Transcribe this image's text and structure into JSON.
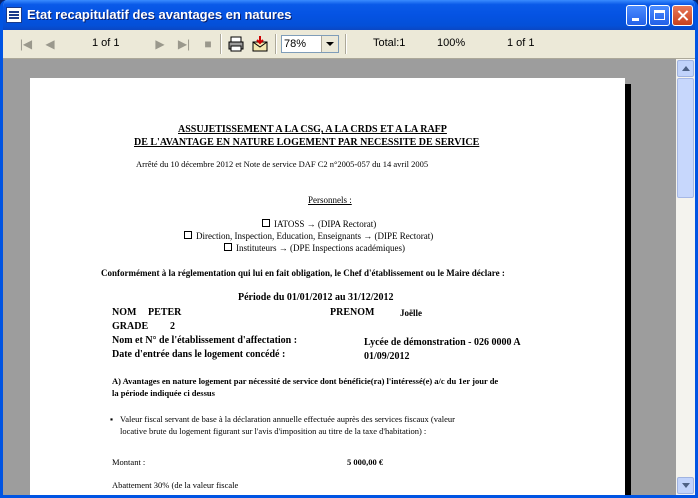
{
  "window": {
    "title": "Etat recapitulatif des avantages en natures"
  },
  "toolbar": {
    "page_indicator": "1 of 1",
    "zoom_value": "78%",
    "total": "Total:1",
    "percent": "100%",
    "page_of": "1 of 1"
  },
  "document": {
    "title_line1": "ASSUJETISSEMENT A LA CSG, A LA CRDS ET A LA RAFP",
    "title_line2": "DE L'AVANTAGE EN NATURE LOGEMENT PAR NECESSITE DE SERVICE",
    "reference": "Arrêté du 10 décembre 2012 et Note de service DAF C2 n°2005-057 du 14 avril 2005",
    "personnels_heading": "Personnels :",
    "personnels": [
      "IATOSS → (DIPA Rectorat)",
      "Direction, Inspection, Education, Enseignants → (DIPE Rectorat)",
      "Instituteurs → (DPE Inspections académiques)"
    ],
    "declaration": "Conformément à la réglementation qui lui en fait obligation, le Chef d'établissement ou le Maire déclare :",
    "periode": "Période du 01/01/2012 au 31/12/2012",
    "nom_label": "NOM",
    "nom_value": "PETER",
    "prenom_label": "PRENOM",
    "prenom_value": "Joëlle",
    "grade_label": "GRADE",
    "grade_value": "2",
    "etab_label": "Nom et N° de l'établissement d'affectation :",
    "etab_value": "Lycée de démonstration - 026 0000 A",
    "date_label": "Date d'entrée dans le logement concédé :",
    "date_value": "01/09/2012",
    "section_a_line1": "A) Avantages en nature logement par nécessité de service dont bénéficie(ra) l'intéressé(e) a/c du 1er jour de",
    "section_a_line2": "la période indiquée ci dessus",
    "bullet_line1": "Valeur fiscal servant de base à la déclaration annuelle effectuée auprès des services fiscaux (valeur",
    "bullet_line2": "locative brute du logement figurant sur l'avis d'imposition au titre de la taxe d'habitation) :",
    "montant_label": "Montant :",
    "montant_value": "5 000,00 €",
    "abattement_label": "Abattement 30% (de la valeur fiscale"
  }
}
